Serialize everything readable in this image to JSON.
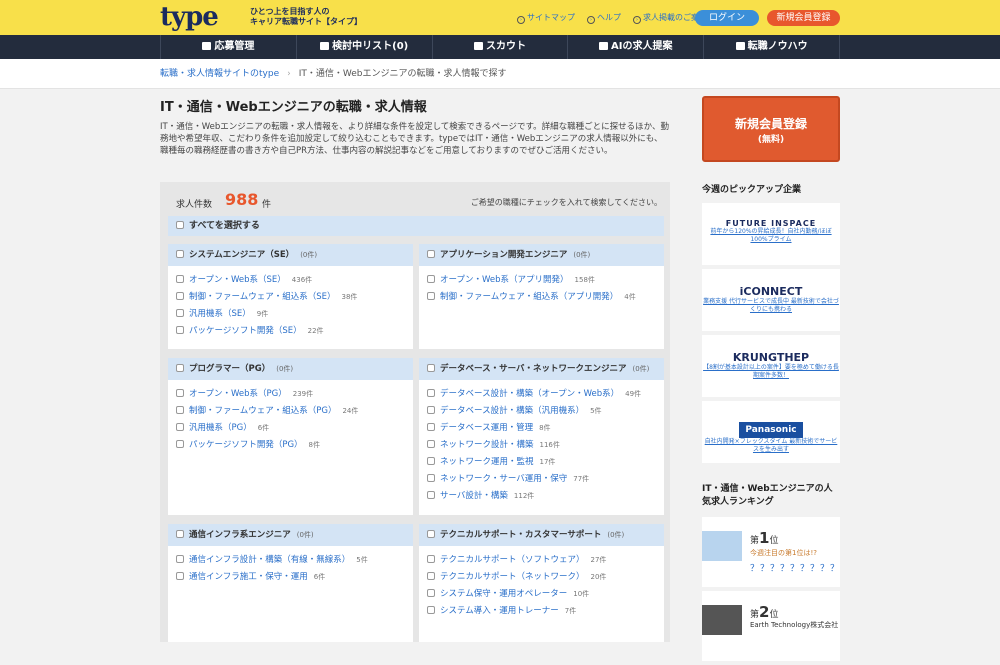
{
  "header": {
    "logo": "type",
    "tagline_1": "ひとつ上を目指す人の",
    "tagline_2": "キャリア転職サイト【タイプ】",
    "links": [
      "サイトマップ",
      "ヘルプ",
      "求人掲載のご案内"
    ],
    "login": "ログイン",
    "register": "新規会員登録"
  },
  "nav": [
    "応募管理",
    "検討中リスト(0)",
    "スカウト",
    "AIの求人提案",
    "転職ノウハウ"
  ],
  "breadcrumb": {
    "home": "転職・求人情報サイトのtype",
    "current": "IT・通信・Webエンジニアの転職・求人情報で探す"
  },
  "page": {
    "title": "IT・通信・Webエンジニアの転職・求人情報",
    "intro": "IT・通信・Webエンジニアの転職・求人情報を、より詳細な条件を設定して検索できるページです。詳細な職種ごとに探せるほか、勤務地や希望年収、こだわり条件を追加設定して絞り込むこともできます。typeではIT・通信・Webエンジニアの求人情報以外にも、職種毎の職務経歴書の書き方や自己PR方法、仕事内容の解説記事などをご用意しておりますのでぜひご活用ください。"
  },
  "search": {
    "count_label": "求人件数",
    "count": "988",
    "count_unit": "件",
    "note": "ご希望の職種にチェックを入れて検索してください。",
    "select_all": "すべてを選択する"
  },
  "categories": [
    {
      "title": "システムエンジニア（SE）",
      "count": "(0件)",
      "items": [
        {
          "label": "オープン・Web系（SE）",
          "count": "436件"
        },
        {
          "label": "制御・ファームウェア・組込系（SE）",
          "count": "38件"
        },
        {
          "label": "汎用機系（SE）",
          "count": "9件"
        },
        {
          "label": "パッケージソフト開発（SE）",
          "count": "22件"
        }
      ]
    },
    {
      "title": "アプリケーション開発エンジニア",
      "count": "(0件)",
      "items": [
        {
          "label": "オープン・Web系（アプリ開発）",
          "count": "158件"
        },
        {
          "label": "制御・ファームウェア・組込系（アプリ開発）",
          "count": "4件"
        }
      ]
    },
    {
      "title": "プログラマー（PG）",
      "count": "(0件)",
      "items": [
        {
          "label": "オープン・Web系（PG）",
          "count": "239件"
        },
        {
          "label": "制御・ファームウェア・組込系（PG）",
          "count": "24件"
        },
        {
          "label": "汎用機系（PG）",
          "count": "6件"
        },
        {
          "label": "パッケージソフト開発（PG）",
          "count": "8件"
        }
      ]
    },
    {
      "title": "データベース・サーバ・ネットワークエンジニア",
      "count": "(0件)",
      "items": [
        {
          "label": "データベース設計・構築（オープン・Web系）",
          "count": "49件"
        },
        {
          "label": "データベース設計・構築（汎用機系）",
          "count": "5件"
        },
        {
          "label": "データベース運用・管理",
          "count": "8件"
        },
        {
          "label": "ネットワーク設計・構築",
          "count": "116件"
        },
        {
          "label": "ネットワーク運用・監視",
          "count": "17件"
        },
        {
          "label": "ネットワーク・サーバ運用・保守",
          "count": "77件"
        },
        {
          "label": "サーバ設計・構築",
          "count": "112件"
        }
      ]
    },
    {
      "title": "通信インフラ系エンジニア",
      "count": "(0件)",
      "items": [
        {
          "label": "通信インフラ設計・構築（有線・無線系）",
          "count": "5件"
        },
        {
          "label": "通信インフラ施工・保守・運用",
          "count": "6件"
        }
      ]
    },
    {
      "title": "テクニカルサポート・カスタマーサポート",
      "count": "(0件)",
      "items": [
        {
          "label": "テクニカルサポート（ソフトウェア）",
          "count": "27件"
        },
        {
          "label": "テクニカルサポート（ネットワーク）",
          "count": "20件"
        },
        {
          "label": "システム保守・運用オペレーター",
          "count": "10件"
        },
        {
          "label": "システム導入・運用トレーナー",
          "count": "7件"
        }
      ]
    }
  ],
  "sidebar": {
    "register": "新規会員登録",
    "register_sub": "(無料)",
    "pickup_title": "今週のピックアップ企業",
    "ads": [
      {
        "name": "FUTURE INSPACE",
        "copy": "前年から120%の昇給成長！自社内勤務/ほぼ100%プライム"
      },
      {
        "name": "iCONNECT",
        "copy": "業務支援 代行サービスで成長中 最新技術で会社づくりにも携わる"
      },
      {
        "name": "KRUNGTHEP",
        "copy": "【8割が基本設計以上の案件】要を極めて働ける長期案件多数！"
      },
      {
        "name": "Panasonic",
        "copy": "自社内開発×フレックスタイム 最新技術でサービスを生み出す"
      }
    ],
    "ranking_title": "IT・通信・Webエンジニアの人気求人ランキング",
    "ranking": [
      {
        "rank": "1",
        "rank_unit": "位",
        "prefix": "第",
        "note": "今週注目の第1位は!?",
        "company": "？？？？？？？？？"
      },
      {
        "rank": "2",
        "rank_unit": "位",
        "prefix": "第",
        "note": "",
        "company": "Earth Technology株式会社"
      }
    ]
  }
}
